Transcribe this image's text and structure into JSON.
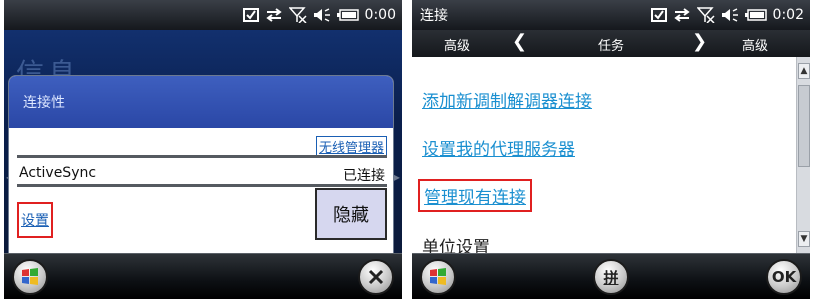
{
  "left": {
    "background_title": "信息",
    "clock": "0:00",
    "dialog": {
      "title": "连接性",
      "wireless_manager_link": "无线管理器",
      "activesync_label": "ActiveSync",
      "activesync_status": "已连接",
      "settings_link": "设置",
      "hide_button": "隐藏"
    },
    "bottom": {
      "start_icon": "windows-start-icon",
      "close_icon": "close-icon"
    }
  },
  "right": {
    "status_title": "连接",
    "clock": "0:02",
    "nav": {
      "left_label": "高级",
      "center_label": "任务",
      "right_label": "高级"
    },
    "tasks": [
      "添加新调制解调器连接",
      "设置我的代理服务器",
      "管理现有连接"
    ],
    "unit_settings": "单位设置",
    "bottom": {
      "start_icon": "windows-start-icon",
      "ime_label": "拼",
      "ok_label": "OK"
    }
  },
  "colors": {
    "link": "#1a8fd0",
    "highlight": "#e02020",
    "dialog_header": "#2a47a6"
  }
}
